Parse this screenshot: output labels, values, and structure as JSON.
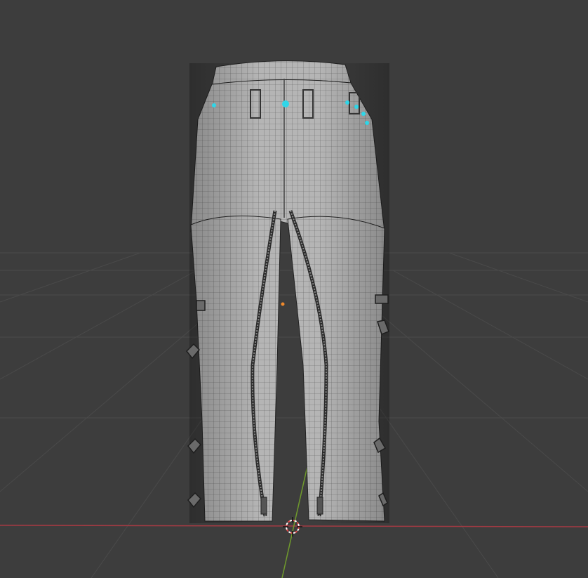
{
  "viewport": {
    "mode": "3D Viewport",
    "background_color": "#3d3d3d",
    "grid_color": "#4a4a4a",
    "x_axis_color": "#a33a43",
    "y_axis_color": "#6f9a2c",
    "mesh_color": "#b8b8b8",
    "wire_color": "#1a1a1a",
    "selected_vertex_color": "#2fd6e8",
    "origin_color": "#f08a2c",
    "cursor_color": "#e04848"
  },
  "object": {
    "name_semantic": "pants-mesh",
    "shading": "solid-with-wireframe",
    "selected_highlights": 6
  },
  "icons": {
    "cursor": "3d-cursor-icon",
    "origin": "object-origin-icon"
  }
}
